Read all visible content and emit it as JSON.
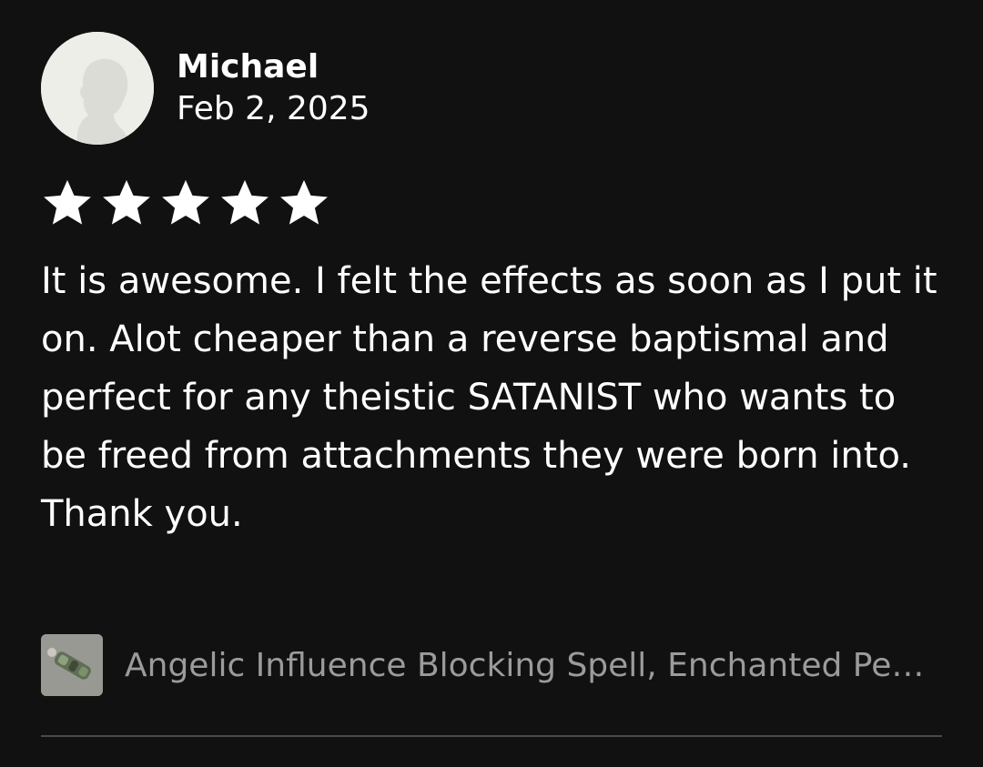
{
  "review": {
    "author": "Michael",
    "date": "Feb 2, 2025",
    "rating": 5,
    "rating_max": 5,
    "text": "It is awesome. I felt the effects as soon as I put it on. Alot cheaper than a reverse baptismal and perfect for any theistic SATANIST who wants to be freed from attachments they were born into. Thank you."
  },
  "listing": {
    "title": "Angelic Influence Blocking Spell, Enchanted Pendant",
    "thumbnail_icon": "product-thumbnail"
  },
  "icons": {
    "avatar": "default-avatar-icon",
    "star": "star-icon"
  },
  "colors": {
    "background": "#111111",
    "text": "#ffffff",
    "muted_text": "#9b9b9b",
    "star": "#ffffff",
    "divider": "#4a4a4a"
  }
}
